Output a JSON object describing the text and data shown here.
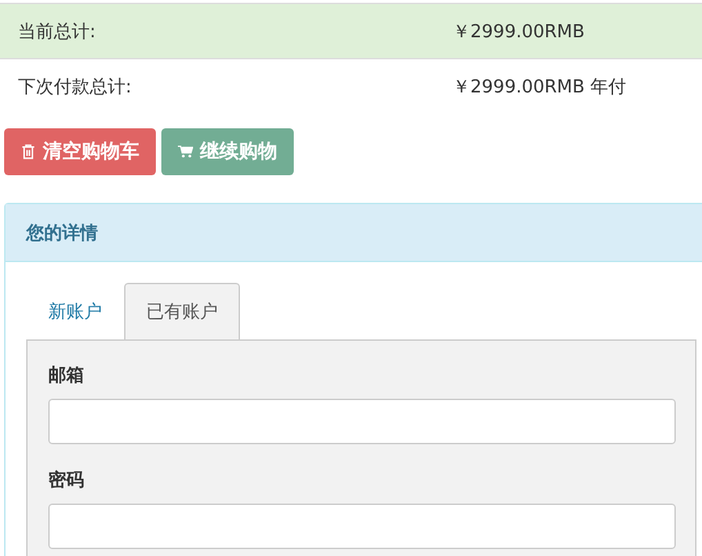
{
  "totals": [
    {
      "label": "当前总计:",
      "value": "￥2999.00RMB",
      "highlighted": true
    },
    {
      "label": "下次付款总计:",
      "value": "￥2999.00RMB 年付",
      "highlighted": false
    }
  ],
  "buttons": [
    {
      "label": "清空购物车",
      "kind": "empty"
    },
    {
      "label": "继续购物",
      "kind": "shop"
    }
  ],
  "panel": {
    "title": "您的详情",
    "tabs": [
      {
        "label": "新账户",
        "selected": false
      },
      {
        "label": "已有账户",
        "selected": true
      }
    ],
    "fields": [
      {
        "label": "邮箱"
      },
      {
        "label": "密码"
      }
    ]
  }
}
